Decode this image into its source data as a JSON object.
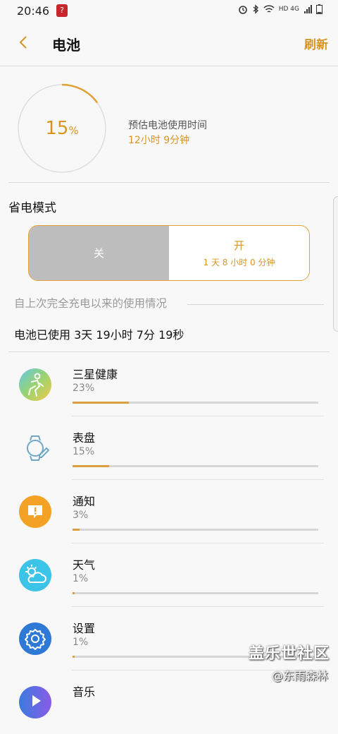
{
  "status_bar": {
    "time": "20:46",
    "signal_text": "HD 4G"
  },
  "header": {
    "title": "电池",
    "refresh_label": "刷新"
  },
  "battery": {
    "percent_value": "15",
    "percent_unit": "%",
    "level_fraction": 0.15,
    "estimate_label": "预估电池使用时间",
    "estimate_value": "12小时 9分钟"
  },
  "power_saving": {
    "title": "省电模式",
    "off_label": "关",
    "on_label": "开",
    "on_sub": "1 天 8 小时 0 分钟"
  },
  "usage": {
    "section_title": "自上次完全充电以来的使用情况",
    "total_text": "电池已使用 3天 19小时 7分 19秒",
    "apps": [
      {
        "name": "三星健康",
        "percent": "23%",
        "level": 0.23,
        "icon": "samsung-health-icon"
      },
      {
        "name": "表盘",
        "percent": "15%",
        "level": 0.15,
        "icon": "watch-face-icon"
      },
      {
        "name": "通知",
        "percent": "3%",
        "level": 0.03,
        "icon": "notification-icon"
      },
      {
        "name": "天气",
        "percent": "1%",
        "level": 0.01,
        "icon": "weather-icon"
      },
      {
        "name": "设置",
        "percent": "1%",
        "level": 0.01,
        "icon": "settings-icon"
      },
      {
        "name": "音乐",
        "percent": "",
        "level": 0.0,
        "icon": "music-icon"
      }
    ]
  },
  "watermark": {
    "line1": "盖乐世社区",
    "line2": "@东雨森林"
  },
  "colors": {
    "accent": "#d99521",
    "off_gray": "#bdbdbd",
    "track": "#d6d6d6"
  }
}
